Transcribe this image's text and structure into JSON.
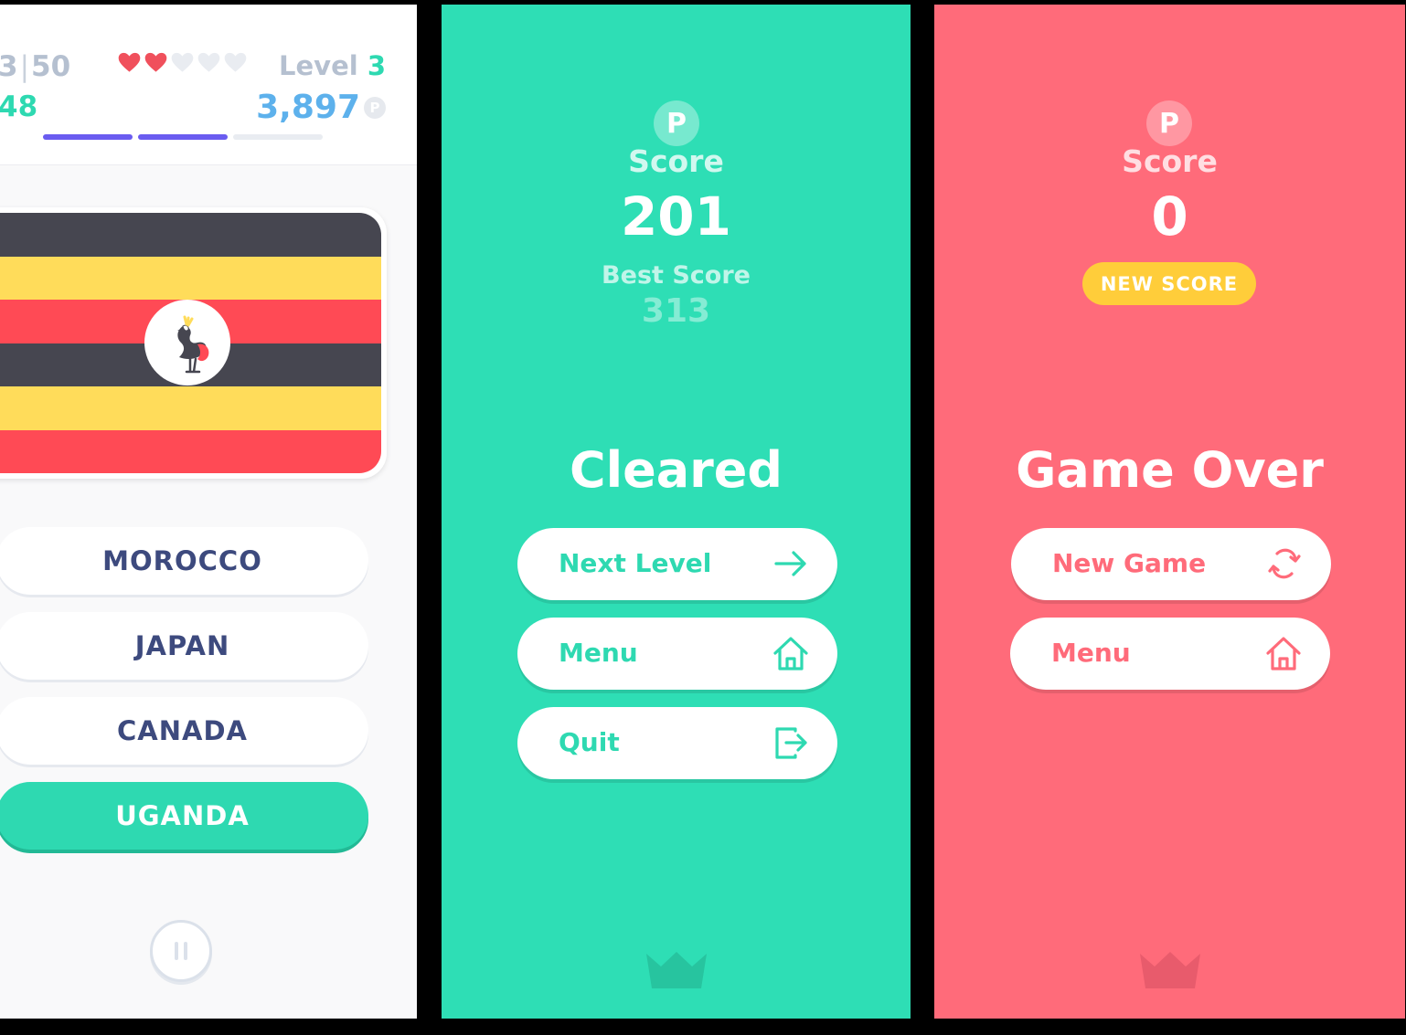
{
  "quiz": {
    "progress_current": "3",
    "progress_separator": "|",
    "progress_total": "50",
    "streak": "48",
    "hearts": {
      "filled": 2,
      "total": 5,
      "filled_color": "#f0505c",
      "empty_color": "#e9ecf1"
    },
    "level_label": "Level",
    "level_value": "3",
    "points": "3,897",
    "points_icon_letter": "P",
    "segments": {
      "filled": 2,
      "total": 3,
      "filled_color": "#6a5cf0",
      "empty_color": "#e9ecf1"
    },
    "flag": {
      "country": "Uganda",
      "stripe_colors": [
        "#464650",
        "#ffdc5a",
        "#ff4a55",
        "#464650",
        "#ffdc5a",
        "#ff4a55"
      ],
      "emblem_icon": "crested-crane-icon"
    },
    "answers": [
      {
        "label": "MOROCCO",
        "state": "default"
      },
      {
        "label": "JAPAN",
        "state": "default"
      },
      {
        "label": "CANADA",
        "state": "default"
      },
      {
        "label": "UGANDA",
        "state": "correct"
      }
    ],
    "pause_icon": "pause-icon"
  },
  "cleared": {
    "background": "#2edeb5",
    "coin_letter": "P",
    "score_label": "Score",
    "score_value": "201",
    "best_label": "Best Score",
    "best_value": "313",
    "title": "Cleared",
    "buttons": [
      {
        "label": "Next Level",
        "icon": "arrow-right-icon"
      },
      {
        "label": "Menu",
        "icon": "home-icon"
      },
      {
        "label": "Quit",
        "icon": "exit-icon"
      }
    ],
    "footer_icon": "crown-icon"
  },
  "gameover": {
    "background": "#ff6b7a",
    "coin_letter": "P",
    "score_label": "Score",
    "score_value": "0",
    "badge": "NEW SCORE",
    "title": "Game Over",
    "buttons": [
      {
        "label": "New Game",
        "icon": "refresh-icon"
      },
      {
        "label": "Menu",
        "icon": "home-icon"
      }
    ],
    "footer_icon": "crown-icon"
  }
}
